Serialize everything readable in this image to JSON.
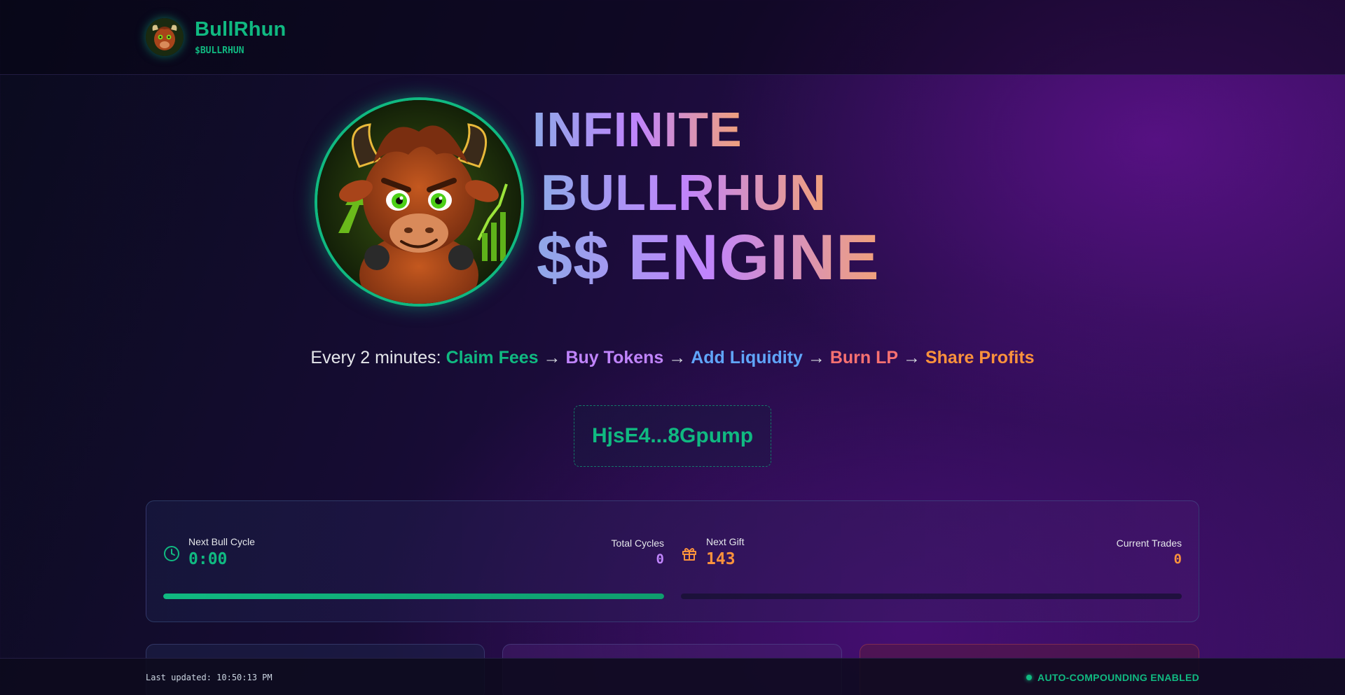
{
  "header": {
    "brand_name": "BullRhun",
    "ticker": "$BULLRHUN"
  },
  "hero": {
    "title_line1": "INFINITE",
    "title_line2": "BULLRHUN",
    "title_line3": "$$ ENGINE"
  },
  "flow": {
    "prefix": "Every 2 minutes:",
    "steps": [
      "Claim Fees",
      "Buy Tokens",
      "Add Liquidity",
      "Burn LP",
      "Share Profits"
    ],
    "arrow": "→"
  },
  "contract": {
    "address_short": "HjsE4...8Gpump"
  },
  "stats": {
    "cycle": {
      "label": "Next Bull Cycle",
      "value": "0:00",
      "right_label": "Total Cycles",
      "right_value": "0",
      "progress": 1.0
    },
    "gift": {
      "label": "Next Gift",
      "value": "143",
      "right_label": "Current Trades",
      "right_value": "0",
      "progress": 0.0
    }
  },
  "footer": {
    "last_updated": "Last updated: 10:50:13 PM",
    "status": "AUTO-COMPOUNDING ENABLED"
  },
  "colors": {
    "accent_green": "#10b981",
    "purple": "#c084fc",
    "blue": "#60a5fa",
    "red": "#f87171",
    "orange": "#fb923c"
  },
  "icons": {
    "cycle": "clock-icon",
    "gift": "gift-icon"
  }
}
